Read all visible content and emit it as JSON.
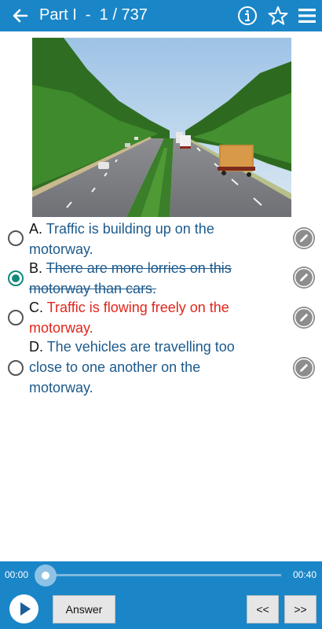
{
  "header": {
    "title": "Part I  -  1 / 737",
    "icons": [
      "back-arrow-icon",
      "info-icon",
      "star-icon",
      "menu-icon"
    ]
  },
  "question": {
    "image": "motorway-traffic-photo",
    "options": [
      {
        "letter": "A.",
        "text": "Traffic is building up on the motorway.",
        "state": "normal"
      },
      {
        "letter": "B.",
        "text": "There are more lorries on this motorway than cars.",
        "state": "selected-struck"
      },
      {
        "letter": "C.",
        "text": "Traffic is flowing freely on the motorway.",
        "state": "incorrect"
      },
      {
        "letter": "D.",
        "text": "The vehicles are travelling too close to one another on the motorway.",
        "state": "normal"
      }
    ]
  },
  "player": {
    "current_time": "00:00",
    "total_time": "00:40",
    "progress": 0,
    "answer_label": "Answer",
    "prev_label": "<<",
    "next_label": ">>"
  },
  "colors": {
    "bar": "#1a86c8",
    "option_text": "#1c5a8c",
    "incorrect_text": "#e0261c",
    "selected_radio": "#13887c"
  }
}
